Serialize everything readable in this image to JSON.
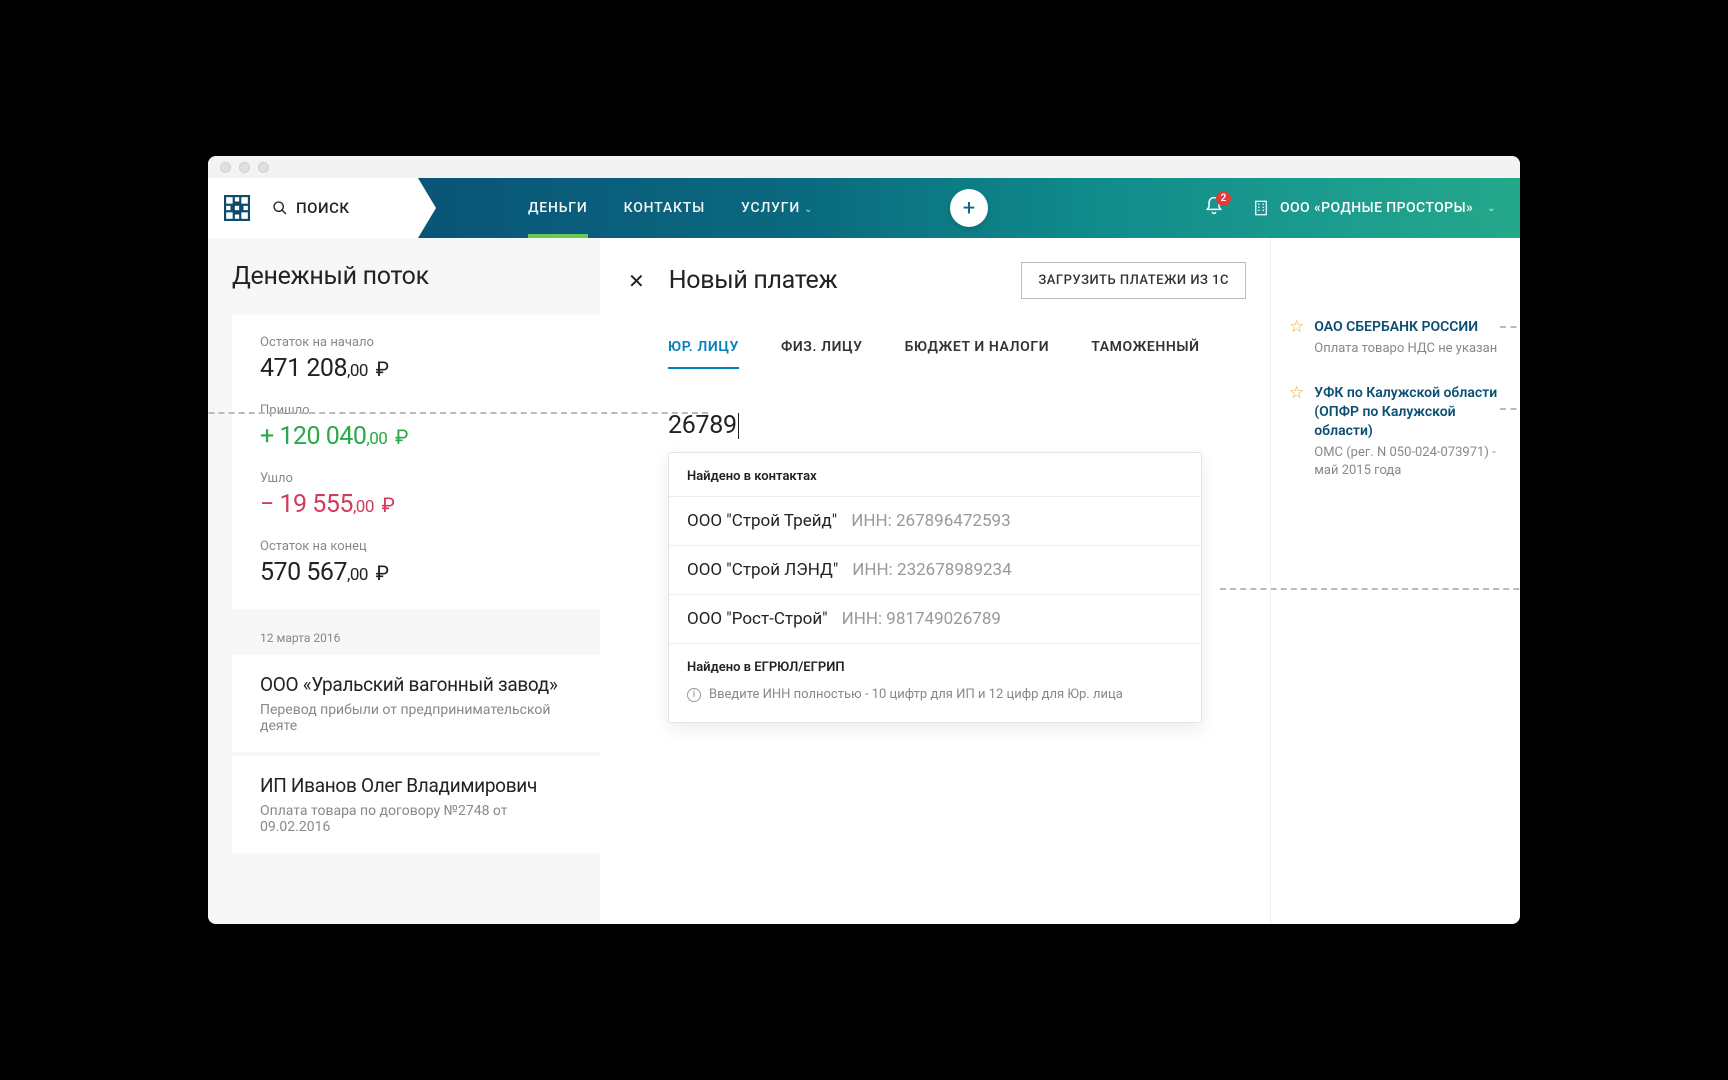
{
  "topbar": {
    "search_label": "ПОИСК",
    "nav": {
      "money": "ДЕНЬГИ",
      "contacts": "КОНТАКТЫ",
      "services": "УСЛУГИ"
    },
    "notification_count": "2",
    "company_name": "ООО «РОДНЫЕ ПРОСТОРЫ»"
  },
  "feed": {
    "title": "Денежный поток",
    "summary": {
      "start_label": "Остаток на начало",
      "start_value_int": "471 208",
      "start_value_dec": ",00",
      "start_cur": "₽",
      "in_label": "Пришло",
      "in_value_int": "+ 120 040",
      "in_value_dec": ",00",
      "in_cur": "₽",
      "out_label": "Ушло",
      "out_value_int": "− 19 555",
      "out_value_dec": ",00",
      "out_cur": "₽",
      "end_label": "Остаток  на конец",
      "end_value_int": "570 567",
      "end_value_dec": ",00",
      "end_cur": "₽"
    },
    "date": "12 марта 2016",
    "cards": [
      {
        "title": "ООО «Уральский вагонный завод»",
        "sub": "Перевод прибыли от предпринимательской деяте"
      },
      {
        "title": "ИП Иванов Олег Владимирович",
        "sub": "Оплата товара по договору №2748 от 09.02.2016"
      }
    ]
  },
  "panel": {
    "title": "Новый платеж",
    "load_btn": "ЗАГРУЗИТЬ ПЛАТЕЖИ ИЗ 1С",
    "tabs": {
      "legal": "ЮР. ЛИЦУ",
      "individual": "ФИЗ. ЛИЦУ",
      "budget": "БЮДЖЕТ И НАЛОГИ",
      "customs": "ТАМОЖЕННЫЙ"
    },
    "search_value": "26789",
    "dropdown": {
      "contacts_header": "Найдено в контактах",
      "items": [
        {
          "name": "ООО \"Строй Трейд\"",
          "inn": "ИНН: 267896472593"
        },
        {
          "name": "ООО \"Строй ЛЭНД\"",
          "inn": "ИНН: 232678989234"
        },
        {
          "name": "ООО \"Рост-Строй\"",
          "inn": "ИНН: 981749026789"
        }
      ],
      "registry_header": "Найдено в ЕГРЮЛ/ЕГРИП",
      "hint": "Введите ИНН полностью - 10 цифтр для ИП и 12 цифр для Юр. лица"
    }
  },
  "favorites": [
    {
      "title": "ОАО СБЕРБАНК РОССИИ",
      "sub": "Оплата товаро НДС не указан"
    },
    {
      "title": "УФК по Калужской области (ОПФР по Калужской области)",
      "sub": "ОМС (рег. N 050-024-073971) - май 2015 года"
    }
  ]
}
